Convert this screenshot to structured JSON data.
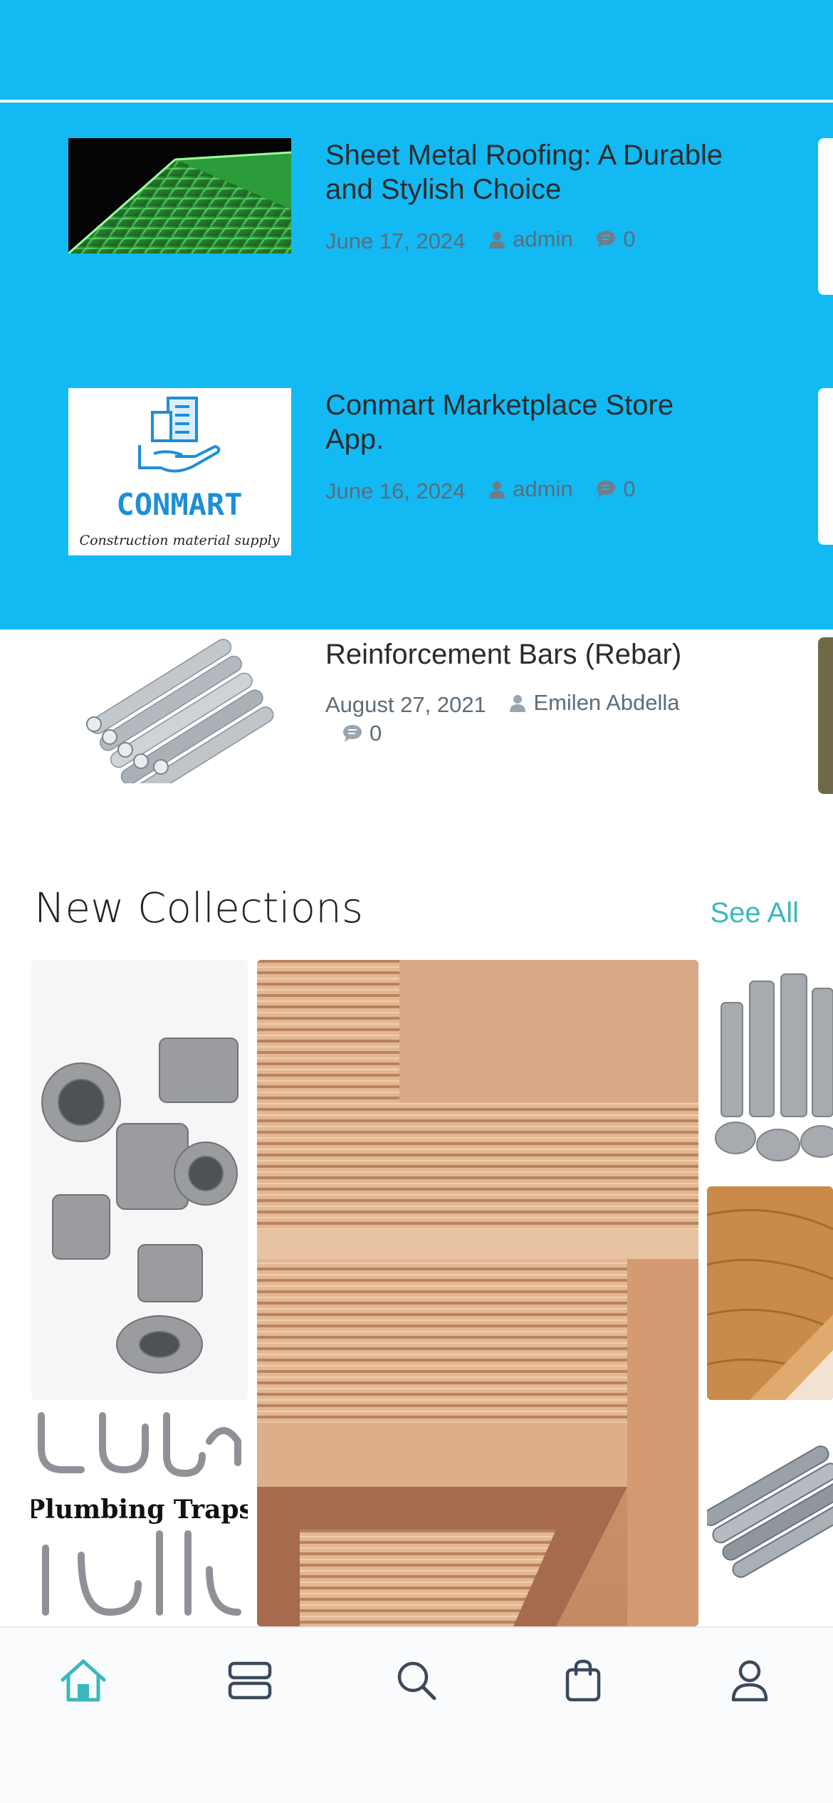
{
  "posts": [
    {
      "title": "Sheet Metal Roofing: A Durable and Stylish Choice",
      "date": "June 17, 2024",
      "author": "admin",
      "comments": "0",
      "thumb_icon": "green-roofing-image"
    },
    {
      "title": "Conmart Marketplace Store App.",
      "date": "June 16, 2024",
      "author": "admin",
      "comments": "0",
      "thumb_icon": "conmart-logo",
      "logo_text": "CONMART",
      "logo_tagline": "Construction material supply"
    },
    {
      "title": "Reinforcement Bars (Rebar)",
      "date": "August 27, 2021",
      "author": "Emilen Abdella",
      "comments": "0",
      "thumb_icon": "rebar-image"
    }
  ],
  "collections": {
    "title": "New Collections",
    "see_all": "See All",
    "tiles": [
      {
        "name": "pipe-fittings-image"
      },
      {
        "name": "plumbing-traps-image",
        "caption": "Plumbing Traps"
      },
      {
        "name": "plywood-image"
      },
      {
        "name": "pvc-pipes-image"
      },
      {
        "name": "wood-flooring-image"
      },
      {
        "name": "rebar-collection-image"
      }
    ]
  },
  "tabbar": {
    "items": [
      {
        "icon": "home-icon",
        "active": true
      },
      {
        "icon": "categories-icon",
        "active": false
      },
      {
        "icon": "search-icon",
        "active": false
      },
      {
        "icon": "shopping-bag-icon",
        "active": false
      },
      {
        "icon": "profile-icon",
        "active": false
      }
    ]
  },
  "colors": {
    "band": "#13b9f3",
    "accent": "#3cb8bc",
    "icon": "#3b4a5a",
    "meta": "#5c6d7a"
  }
}
